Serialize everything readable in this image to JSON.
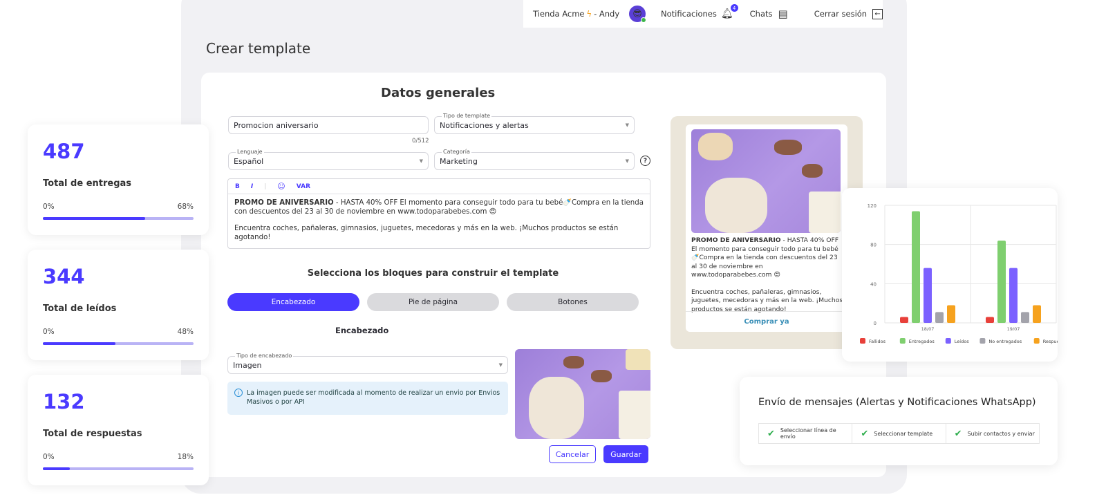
{
  "topbar": {
    "store": "Tienda Acme",
    "separator": "- Andy",
    "avatar_emoji": "😎",
    "notifications": "Notificaciones",
    "notifications_count": "4",
    "chats": "Chats",
    "logout": "Cerrar sesión"
  },
  "page": {
    "title": "Crear template"
  },
  "form": {
    "heading": "Datos generales",
    "name_value": "Promocion aniversario",
    "name_counter": "0/512",
    "template_type_label": "Tipo de template",
    "template_type_value": "Notificaciones y alertas",
    "language_label": "Lenguaje",
    "language_value": "Español",
    "category_label": "Categoría",
    "category_value": "Marketing",
    "editor": {
      "bold": "B",
      "italic": "I",
      "var": "VAR",
      "bold_text": "PROMO DE ANIVERSARIO",
      "line1": " - HASTA 40% OFF El momento para conseguir todo para tu bebé🍼Compra en la tienda con descuentos del 23 al 30 de noviembre en www.todoparabebes.com 😍",
      "line2": "Encuentra coches, pañaleras, gimnasios, juguetes, mecedoras y más en la web. ¡Muchos productos se están agotando!"
    },
    "blocks_heading": "Selecciona los bloques para construir el template",
    "blocks": [
      {
        "label": "Encabezado",
        "active": true
      },
      {
        "label": "Pie de página",
        "active": false
      },
      {
        "label": "Botones",
        "active": false
      }
    ],
    "section_heading": "Encabezado",
    "header_type_label": "Tipo de encabezado",
    "header_type_value": "Imagen",
    "info_text": "La imagen puede ser modificada al momento de realizar un envio por Envios Masivos o por API",
    "cancel": "Cancelar",
    "save": "Guardar"
  },
  "preview": {
    "bold_text": "PROMO DE ANIVERSARIO",
    "line1": " - HASTA 40% OFF El momento para conseguir todo para tu bebé🍼Compra en la tienda con descuentos del 23 al 30 de noviembre en www.todoparabebes.com 😍",
    "line2": "Encuentra coches, pañaleras, gimnasios, juguetes, mecedoras y más en la web. ¡Muchos productos se están agotando!",
    "button": "Comprar ya"
  },
  "stats": [
    {
      "value": "487",
      "label": "Total de entregas",
      "min": "0%",
      "max": "68%",
      "progress": 68
    },
    {
      "value": "344",
      "label": "Total de leídos",
      "min": "0%",
      "max": "48%",
      "progress": 48
    },
    {
      "value": "132",
      "label": "Total de respuestas",
      "min": "0%",
      "max": "18%",
      "progress": 18
    }
  ],
  "chart_data": {
    "type": "bar",
    "categories": [
      "18/07",
      "19/07"
    ],
    "ylim": [
      0,
      120
    ],
    "yticks": [
      "0",
      "40",
      "80",
      "120"
    ],
    "grid": true,
    "legend": "bottom",
    "series": [
      {
        "name": "Fallidos",
        "color": "#e8403a",
        "values": [
          6,
          6
        ]
      },
      {
        "name": "Entregados",
        "color": "#7fcf6f",
        "values": [
          114,
          84
        ]
      },
      {
        "name": "Leídos",
        "color": "#7b61ff",
        "values": [
          56,
          56
        ]
      },
      {
        "name": "No entregados",
        "color": "#a3a3ab",
        "values": [
          11,
          11
        ]
      },
      {
        "name": "Respuestas",
        "color": "#f6a21e",
        "values": [
          18,
          18
        ]
      }
    ]
  },
  "stepper": {
    "title": "Envío de mensajes (Alertas y Notificaciones WhatsApp)",
    "steps": [
      "Seleccionar línea de envío",
      "Seleccionar template",
      "Subir contactos y enviar"
    ]
  },
  "colors": {
    "accent": "#4a3aff",
    "success": "#2fae4e"
  }
}
